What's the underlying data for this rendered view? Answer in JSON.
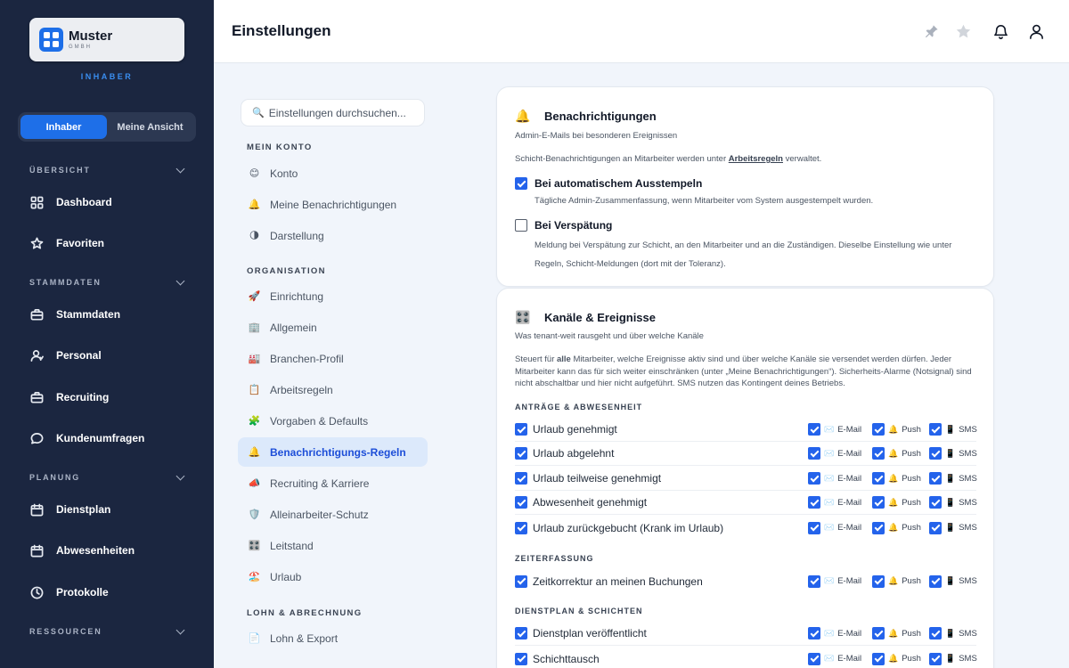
{
  "brand": {
    "name": "Muster",
    "sub": "GMBH",
    "role": "INHABER"
  },
  "view_toggle": {
    "options": [
      "Inhaber",
      "Meine Ansicht"
    ],
    "selected": "Inhaber"
  },
  "sidebar": {
    "sections": [
      {
        "label": "ÜBERSICHT"
      },
      {
        "label": "STAMMDATEN"
      },
      {
        "label": "PLANUNG"
      },
      {
        "label": "RESSOURCEN"
      }
    ],
    "items": [
      {
        "label": "Dashboard",
        "icon": "grid-icon"
      },
      {
        "label": "Favoriten",
        "icon": "star-icon"
      },
      {
        "label": "Stammdaten",
        "icon": "briefcase-icon"
      },
      {
        "label": "Personal",
        "icon": "user-icon"
      },
      {
        "label": "Recruiting",
        "icon": "briefcase-icon"
      },
      {
        "label": "Kundenumfragen",
        "icon": "chat-icon"
      },
      {
        "label": "Dienstplan",
        "icon": "calendar-icon"
      },
      {
        "label": "Abwesenheiten",
        "icon": "calendar-icon"
      },
      {
        "label": "Protokolle",
        "icon": "clock-icon"
      }
    ]
  },
  "header": {
    "title": "Einstellungen",
    "icons": [
      "pin-icon",
      "star-icon",
      "bell-icon",
      "user-icon"
    ]
  },
  "settings_nav": {
    "search_placeholder": "Einstellungen durchsuchen...",
    "groups": [
      {
        "label": "MEIN KONTO",
        "items": [
          {
            "label": "Konto",
            "icon": "😊"
          },
          {
            "label": "Meine Benachrichtigungen",
            "icon": "🔔"
          },
          {
            "label": "Darstellung",
            "icon": "🌗"
          }
        ]
      },
      {
        "label": "ORGANISATION",
        "items": [
          {
            "label": "Einrichtung",
            "icon": "🚀"
          },
          {
            "label": "Allgemein",
            "icon": "🏢"
          },
          {
            "label": "Branchen-Profil",
            "icon": "🏭"
          },
          {
            "label": "Arbeitsregeln",
            "icon": "📋"
          },
          {
            "label": "Vorgaben & Defaults",
            "icon": "🧩"
          },
          {
            "label": "Benachrichtigungs-Regeln",
            "icon": "🔔",
            "active": true
          },
          {
            "label": "Recruiting & Karriere",
            "icon": "📣"
          },
          {
            "label": "Alleinarbeiter-Schutz",
            "icon": "🛡️"
          },
          {
            "label": "Leitstand",
            "icon": "🎛️"
          },
          {
            "label": "Urlaub",
            "icon": "🏖️"
          }
        ]
      },
      {
        "label": "LOHN & ABRECHNUNG",
        "items": [
          {
            "label": "Lohn & Export",
            "icon": "📄"
          }
        ]
      }
    ]
  },
  "card_notifications": {
    "icon": "🔔",
    "title": "Benachrichtigungen",
    "subtitle": "Admin-E-Mails bei besonderen Ereignissen",
    "info_pre": "Schicht-Benachrichtigungen an Mitarbeiter werden unter ",
    "info_link": "Arbeitsregeln",
    "info_post": " verwaltet.",
    "options": [
      {
        "label": "Bei automatischem Ausstempeln",
        "checked": true,
        "desc": "Tägliche Admin-Zusammenfassung, wenn Mitarbeiter vom System ausgestempelt wurden."
      },
      {
        "label": "Bei Verspätung",
        "checked": false,
        "desc": "Meldung bei Verspätung zur Schicht, an den Mitarbeiter und an die Zuständigen. Dieselbe Einstellung wie unter Regeln, Schicht-Meldungen (dort mit der Toleranz)."
      }
    ]
  },
  "card_channels": {
    "icon": "🎛️",
    "title": "Kanäle & Ereignisse",
    "subtitle": "Was tenant-weit rausgeht und über welche Kanäle",
    "desc_pre": "Steuert für ",
    "desc_bold": "alle",
    "desc_post": " Mitarbeiter, welche Ereignisse aktiv sind und über welche Kanäle sie versendet werden dürfen. Jeder Mitarbeiter kann das für sich weiter einschränken (unter „Meine Benachrichtigungen“). Sicherheits-Alarme (Notsignal) sind nicht abschaltbar und hier nicht aufgeführt. SMS nutzen das Kontingent deines Betriebs.",
    "channels": {
      "email": "E-Mail",
      "push": "Push",
      "sms": "SMS"
    },
    "sections": [
      {
        "label": "ANTRÄGE & ABWESENHEIT",
        "rows": [
          "Urlaub genehmigt",
          "Urlaub abgelehnt",
          "Urlaub teilweise genehmigt",
          "Abwesenheit genehmigt",
          "Urlaub zurückgebucht (Krank im Urlaub)"
        ]
      },
      {
        "label": "ZEITERFASSUNG",
        "rows": [
          "Zeitkorrektur an meinen Buchungen"
        ]
      },
      {
        "label": "DIENSTPLAN & SCHICHTEN",
        "rows": [
          "Dienstplan veröffentlicht",
          "Schichttausch"
        ]
      }
    ]
  },
  "colors": {
    "sidebar_bg": "#1b2640",
    "accent": "#1e6fe8",
    "active_nav_bg": "#dce9fb"
  }
}
